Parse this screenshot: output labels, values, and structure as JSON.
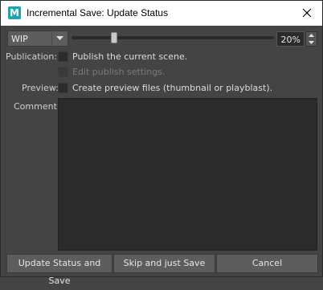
{
  "window": {
    "title": "Incremental Save: Update Status",
    "app_icon_letter": "M"
  },
  "status": {
    "selected": "WIP",
    "completion": 20,
    "percent_text": "20%"
  },
  "publication": {
    "label": "Publication:",
    "publish_text": "Publish the current scene.",
    "edit_text": "Edit publish settings."
  },
  "preview": {
    "label": "Preview:",
    "text": "Create preview files (thumbnail or playblast)."
  },
  "comment": {
    "label": "Comment:",
    "value": ""
  },
  "buttons": {
    "update": "Update Status and Save",
    "skip": "Skip and just Save",
    "cancel": "Cancel"
  }
}
